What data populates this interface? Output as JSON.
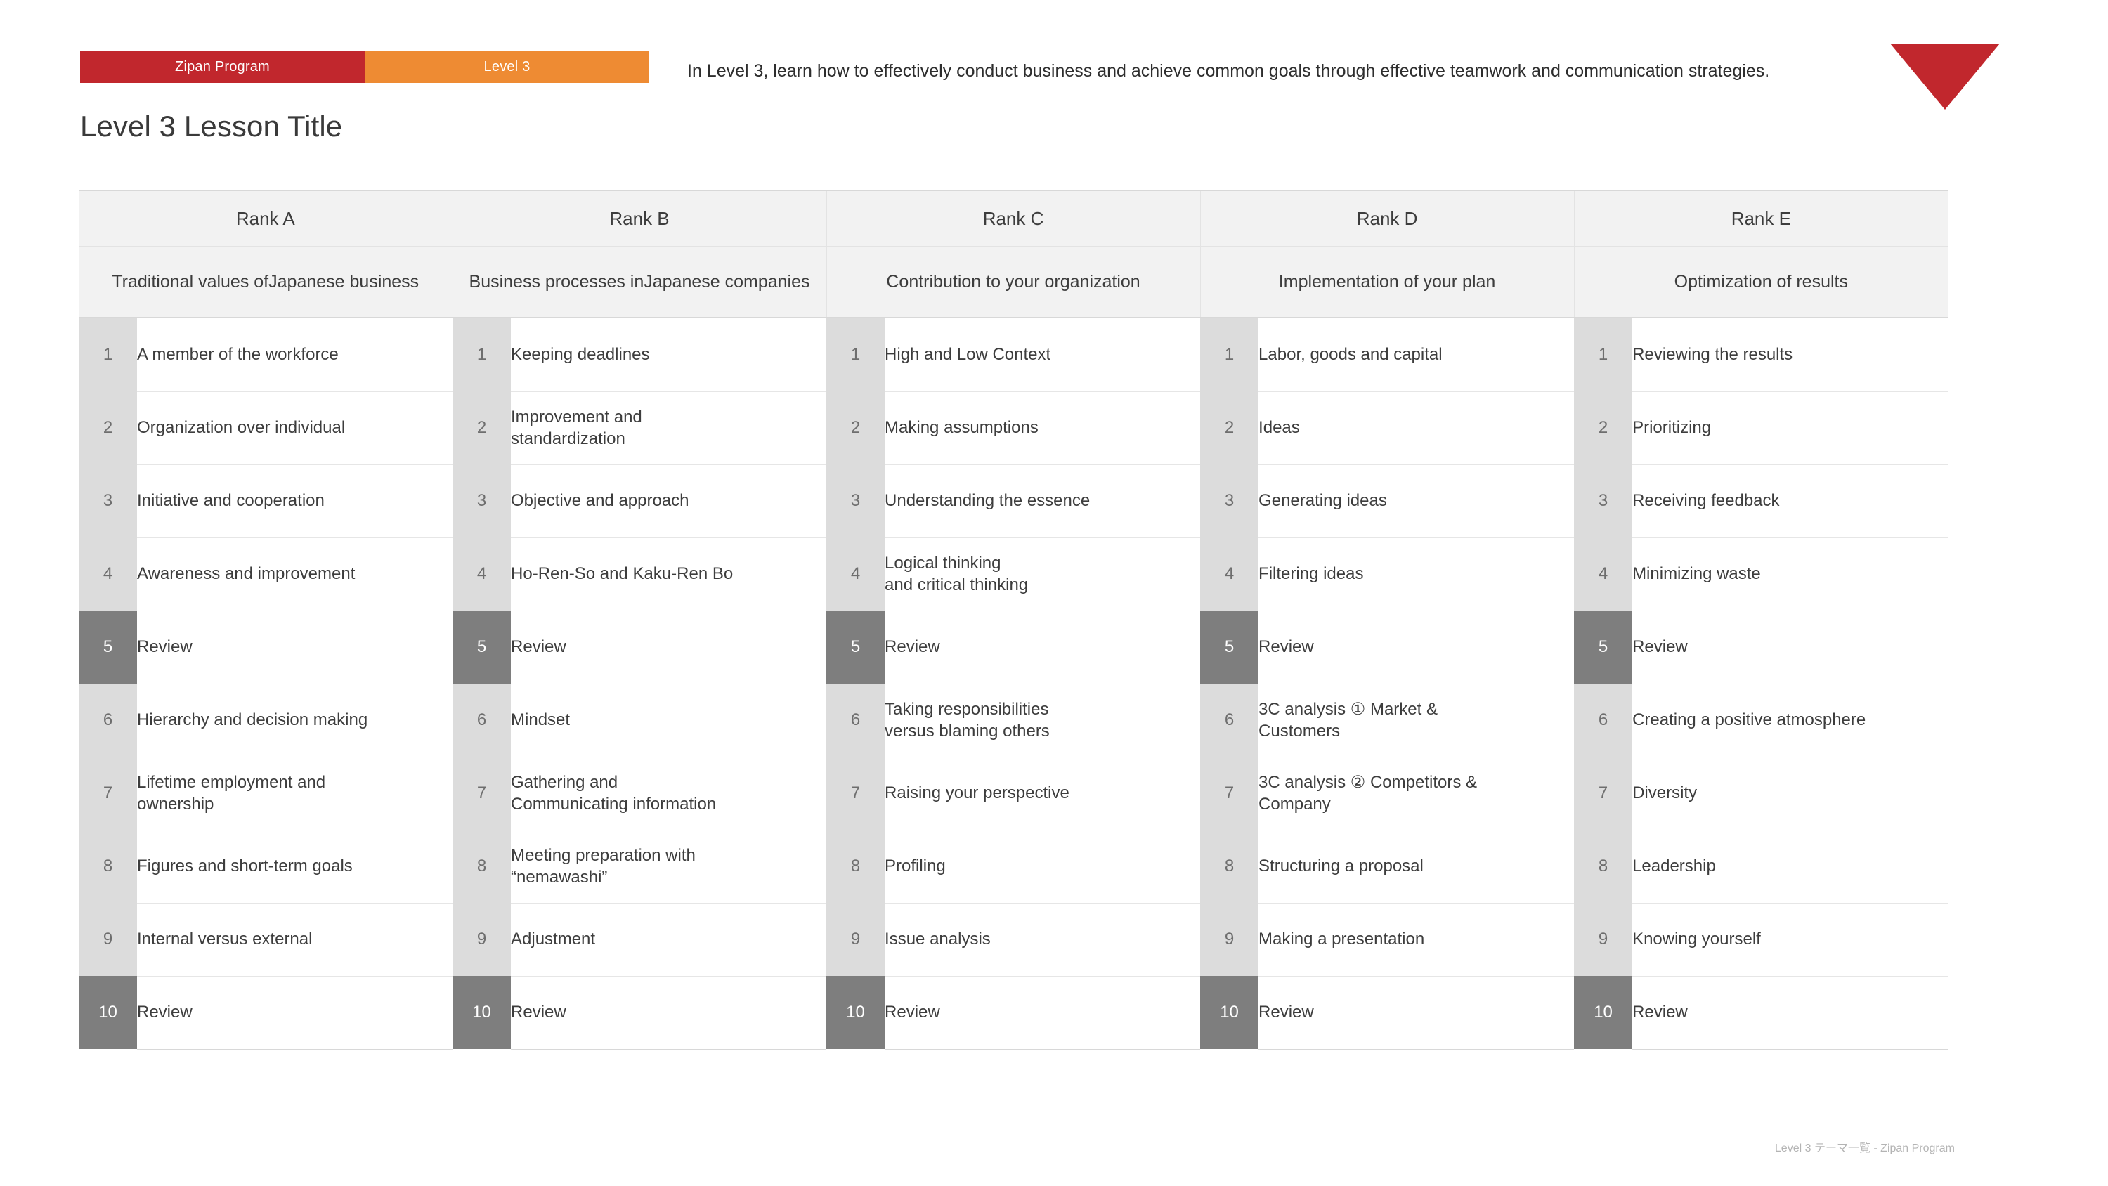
{
  "header": {
    "brand_badge": "Zipan Program",
    "level_badge": "Level 3",
    "title": "Level 3 Lesson Title",
    "intro": "In Level 3, learn how to effectively conduct business and achieve common goals through effective teamwork and communication strategies.",
    "logo_icon": "red-triangle-logo"
  },
  "footer": {
    "note": "Level 3 テーマ一覧 - Zipan Program"
  },
  "colors": {
    "brand_red": "#C1272D",
    "level_orange": "#EE8B33",
    "header_fill": "#F2F2F2",
    "number_fill": "#DCDCDC",
    "review_fill": "#7E7E7E"
  },
  "table": {
    "row_numbers": [
      "1",
      "2",
      "3",
      "4",
      "5",
      "6",
      "7",
      "8",
      "9",
      "10"
    ],
    "review_rows": [
      5,
      10
    ],
    "columns": [
      {
        "rank": "Rank A",
        "theme_line1": "Traditional values of",
        "theme_line2": "Japanese business",
        "lessons": [
          {
            "line1": "A member of the workforce",
            "line2": ""
          },
          {
            "line1": "Organization over individual",
            "line2": ""
          },
          {
            "line1": "Initiative and cooperation",
            "line2": ""
          },
          {
            "line1": "Awareness and improvement",
            "line2": ""
          },
          {
            "line1": "Review",
            "line2": ""
          },
          {
            "line1": "Hierarchy and decision making",
            "line2": ""
          },
          {
            "line1": "Lifetime employment and",
            "line2": "ownership"
          },
          {
            "line1": "Figures and short-term goals",
            "line2": ""
          },
          {
            "line1": "Internal versus external",
            "line2": ""
          },
          {
            "line1": "Review",
            "line2": ""
          }
        ]
      },
      {
        "rank": "Rank B",
        "theme_line1": "Business processes in",
        "theme_line2": "Japanese companies",
        "lessons": [
          {
            "line1": "Keeping deadlines",
            "line2": ""
          },
          {
            "line1": "Improvement and",
            "line2": "standardization"
          },
          {
            "line1": "Objective and approach",
            "line2": ""
          },
          {
            "line1": "Ho-Ren-So and Kaku-Ren Bo",
            "line2": ""
          },
          {
            "line1": "Review",
            "line2": ""
          },
          {
            "line1": "Mindset",
            "line2": ""
          },
          {
            "line1": "Gathering and",
            "line2": "Communicating information"
          },
          {
            "line1": "Meeting preparation with",
            "line2": "“nemawashi”"
          },
          {
            "line1": "Adjustment",
            "line2": ""
          },
          {
            "line1": "Review",
            "line2": ""
          }
        ]
      },
      {
        "rank": "Rank C",
        "theme_line1": "Contribution to your organization",
        "theme_line2": "",
        "lessons": [
          {
            "line1": "High and Low Context",
            "line2": ""
          },
          {
            "line1": "Making assumptions",
            "line2": ""
          },
          {
            "line1": "Understanding the essence",
            "line2": ""
          },
          {
            "line1": "Logical thinking",
            "line2": "and critical thinking"
          },
          {
            "line1": "Review",
            "line2": ""
          },
          {
            "line1": "Taking responsibilities",
            "line2": "versus blaming others"
          },
          {
            "line1": "Raising your perspective",
            "line2": ""
          },
          {
            "line1": "Profiling",
            "line2": ""
          },
          {
            "line1": "Issue analysis",
            "line2": ""
          },
          {
            "line1": "Review",
            "line2": ""
          }
        ]
      },
      {
        "rank": "Rank D",
        "theme_line1": "Implementation of your plan",
        "theme_line2": "",
        "lessons": [
          {
            "line1": "Labor, goods and capital",
            "line2": ""
          },
          {
            "line1": "Ideas",
            "line2": ""
          },
          {
            "line1": "Generating ideas",
            "line2": ""
          },
          {
            "line1": "Filtering ideas",
            "line2": ""
          },
          {
            "line1": "Review",
            "line2": ""
          },
          {
            "line1": "3C analysis ① Market &",
            "line2": "Customers"
          },
          {
            "line1": "3C analysis ② Competitors &",
            "line2": "Company"
          },
          {
            "line1": "Structuring a proposal",
            "line2": ""
          },
          {
            "line1": "Making a presentation",
            "line2": ""
          },
          {
            "line1": "Review",
            "line2": ""
          }
        ]
      },
      {
        "rank": "Rank E",
        "theme_line1": "Optimization of results",
        "theme_line2": "",
        "lessons": [
          {
            "line1": "Reviewing the results",
            "line2": ""
          },
          {
            "line1": "Prioritizing",
            "line2": ""
          },
          {
            "line1": "Receiving feedback",
            "line2": ""
          },
          {
            "line1": "Minimizing waste",
            "line2": ""
          },
          {
            "line1": "Review",
            "line2": ""
          },
          {
            "line1": "Creating a positive atmosphere",
            "line2": ""
          },
          {
            "line1": "Diversity",
            "line2": ""
          },
          {
            "line1": "Leadership",
            "line2": ""
          },
          {
            "line1": "Knowing yourself",
            "line2": ""
          },
          {
            "line1": "Review",
            "line2": ""
          }
        ]
      }
    ]
  }
}
